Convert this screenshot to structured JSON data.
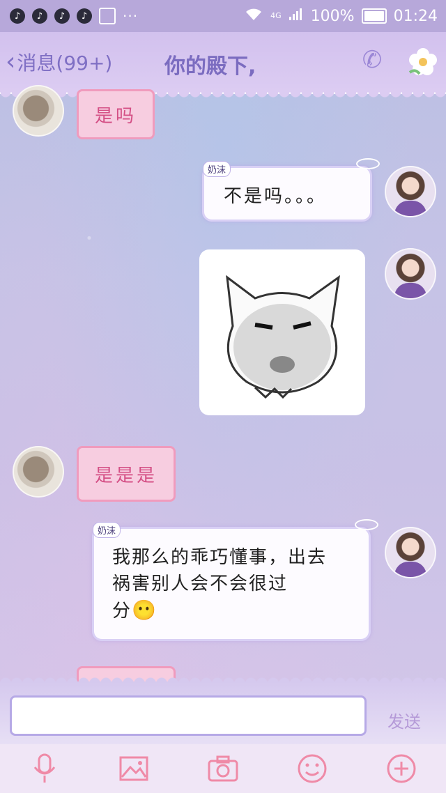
{
  "status_bar": {
    "battery": "100%",
    "time": "01:24",
    "network": "4G",
    "battery_level": 1.0
  },
  "header": {
    "back_label": "消息(99+)",
    "title": "你的殿下,"
  },
  "messages": [
    {
      "side": "left",
      "type": "text",
      "text": "是吗"
    },
    {
      "side": "right",
      "type": "text",
      "text": "不是吗。。。",
      "nickname": "奶沫"
    },
    {
      "side": "right",
      "type": "sticker"
    },
    {
      "side": "left",
      "type": "text",
      "text": "是是是"
    },
    {
      "side": "right",
      "type": "text",
      "text_line1": "我那么的乖巧懂事，出去",
      "text_line2": "祸害别人会不会很过",
      "text_line3": "分",
      "emoji": "😶",
      "nickname": "奶沫"
    }
  ],
  "input": {
    "value": "",
    "send_label": "发送"
  },
  "toolbar": {
    "icons": [
      "microphone-icon",
      "image-icon",
      "camera-icon",
      "emoji-icon",
      "plus-icon"
    ]
  },
  "colors": {
    "header_text": "#7b6cc0",
    "pink_bubble": "#f7cde0",
    "pink_text": "#d44f85",
    "toolbar_icon": "#ef8aa7"
  }
}
